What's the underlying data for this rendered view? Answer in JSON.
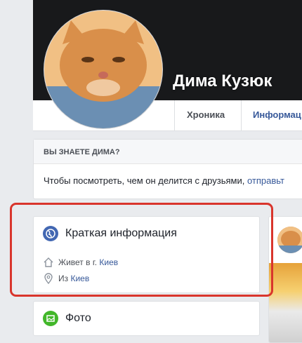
{
  "profile": {
    "name": "Дима Кузюк",
    "tabs": [
      {
        "label": "Хроника"
      },
      {
        "label": "Информац"
      }
    ]
  },
  "know_box": {
    "title": "ВЫ ЗНАЕТЕ ДИМА?",
    "text": "Чтобы посмотреть, чем он делится с друзьями, ",
    "link": "отправьт"
  },
  "intro": {
    "title": "Краткая информация",
    "lives_prefix": "Живет в г. ",
    "lives_link": "Киев",
    "from_prefix": "Из ",
    "from_link": "Киев"
  },
  "photos": {
    "title": "Фото"
  },
  "colors": {
    "link": "#365899",
    "highlight": "#d9352c",
    "globe": "#4267b2",
    "photo_icon": "#42b72a"
  }
}
